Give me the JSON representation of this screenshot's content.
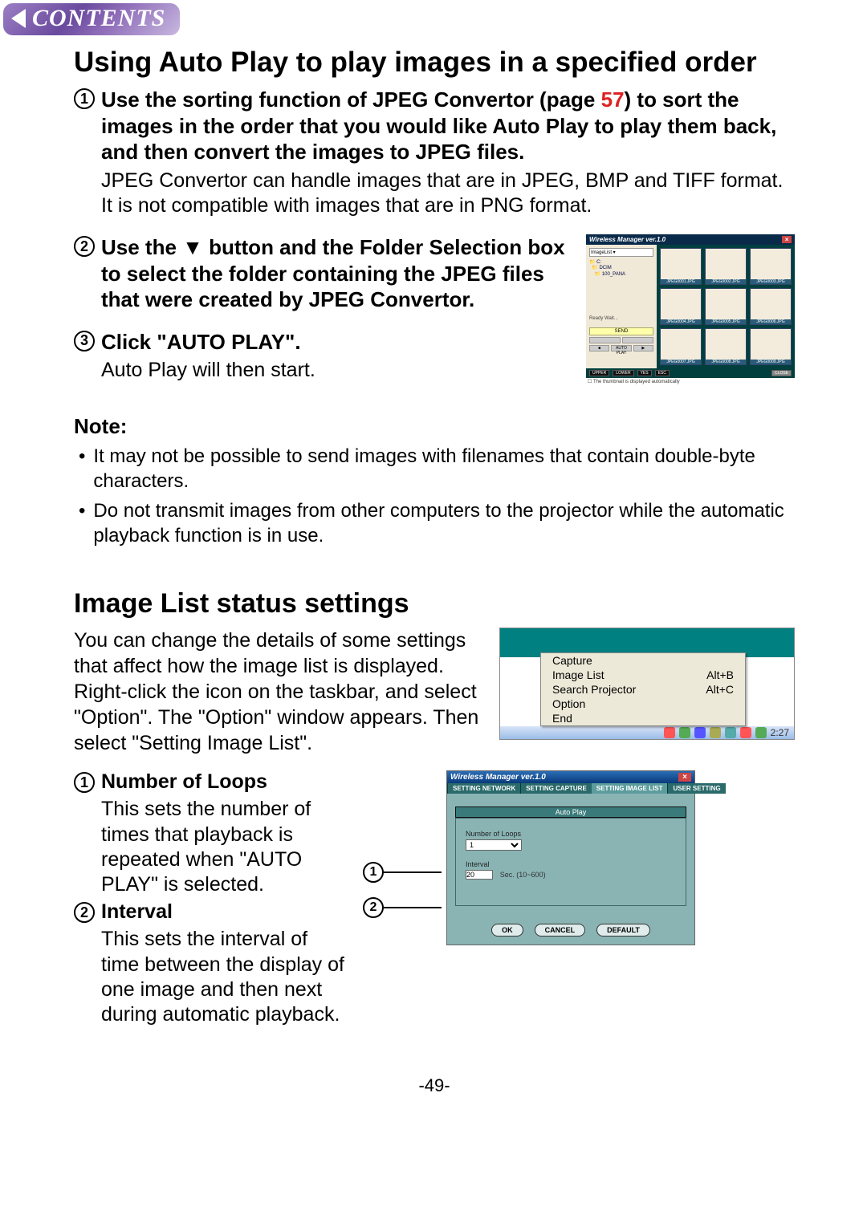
{
  "banner": {
    "label": "CONTENTS"
  },
  "title1": "Using Auto Play to play images in a specified order",
  "step1": {
    "num": "1",
    "bold_a": "Use the sorting function of JPEG Convertor (page ",
    "pageref": "57",
    "bold_b": ") to sort the images in the order that you would like Auto Play to play them back, and then convert the images to JPEG files.",
    "reg": "JPEG Convertor can handle images that are in JPEG, BMP and TIFF format. It is not compatible with images that are in PNG format."
  },
  "step2": {
    "num": "2",
    "bold": "Use the ▼ button and the Folder Selection box to select the folder containing the JPEG files that were created by JPEG Convertor."
  },
  "step3": {
    "num": "3",
    "bold": "Click \"AUTO PLAY\".",
    "reg": "Auto Play will then start."
  },
  "note_label": "Note:",
  "notes": [
    "It may not be possible to send images with filenames that contain double-byte characters.",
    "Do not transmit images from other computers to the projector while the automatic playback function is in use."
  ],
  "title2": "Image List status settings",
  "intro": "You can change the details of some settings that affect how the image list is displayed. Right-click the icon on the taskbar, and select \"Option\". The \"Option\" window appears. Then select \"Setting Image List\".",
  "sub1": {
    "num": "1",
    "head": "Number of Loops",
    "body": "This sets the number of times that playback is repeated when \"AUTO PLAY\" is selected."
  },
  "sub2": {
    "num": "2",
    "head": "Interval",
    "body": "This sets the interval of time between the display of one image and then next during automatic playback."
  },
  "page_number": "-49-",
  "shot1": {
    "title": "Wireless Manager ver.1.0",
    "send": "SEND",
    "auto": "AUTO PLAY",
    "btns": {
      "upper": "UPPER",
      "lower": "LOWER",
      "yes": "YES",
      "esc": "ESC",
      "close": "CLOSE"
    }
  },
  "shot2": {
    "menu": [
      {
        "label": "Capture",
        "sc": ""
      },
      {
        "label": "Image List",
        "sc": "Alt+B"
      },
      {
        "label": "Search Projector",
        "sc": "Alt+C"
      },
      {
        "label": "Option",
        "sc": ""
      },
      {
        "label": "End",
        "sc": ""
      }
    ],
    "clock": "2:27"
  },
  "shot3": {
    "title": "Wireless Manager ver.1.0",
    "tabs": [
      "SETTING NETWORK",
      "SETTING CAPTURE",
      "SETTING IMAGE LIST",
      "USER SETTING"
    ],
    "section": "Auto Play",
    "loops_label": "Number of Loops",
    "loops_value": "1",
    "interval_label": "Interval",
    "interval_value": "20",
    "interval_hint": "Sec. (10~600)",
    "ok": "OK",
    "cancel": "CANCEL",
    "default": "DEFAULT"
  }
}
